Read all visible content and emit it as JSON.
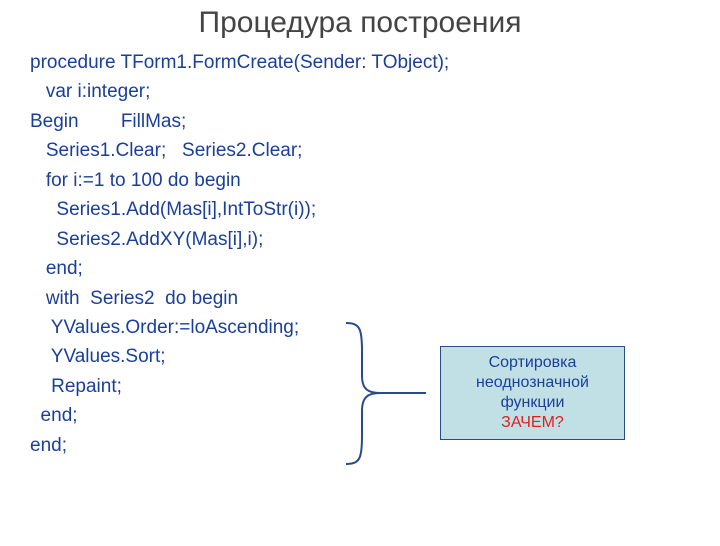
{
  "title": "Процедура построения",
  "code": {
    "l1": "procedure TForm1.FormCreate(Sender: TObject);",
    "l2": "   var i:integer;",
    "l3": "Begin        FillMas;",
    "l4": "   Series1.Clear;   Series2.Clear;",
    "l5": "   for i:=1 to 100 do begin",
    "l6": "     Series1.Add(Mas[i],IntToStr(i));",
    "l7": "     Series2.AddXY(Mas[i],i);",
    "l8": "   end;",
    "l9": "   with  Series2  do begin",
    "l10": "    YValues.Order:=loAscending;",
    "l11": "    YValues.Sort;",
    "l12": "    Repaint;",
    "l13": "  end;",
    "l14": "end;"
  },
  "callout": {
    "line1": "Сортировка",
    "line2": "неоднозначной",
    "line3": "функции",
    "question": "ЗАЧЕМ?"
  }
}
